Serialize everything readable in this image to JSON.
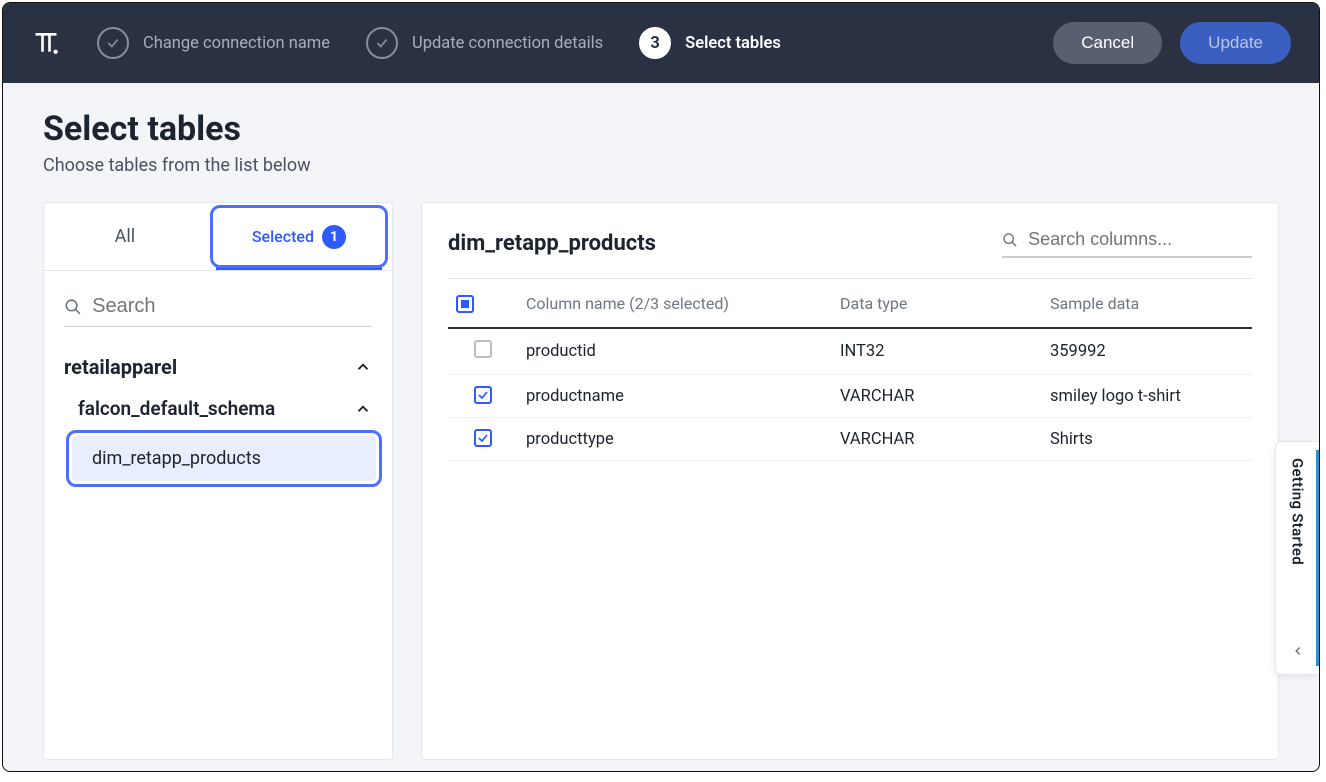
{
  "topbar": {
    "steps": [
      {
        "label": "Change connection name",
        "state": "done"
      },
      {
        "label": "Update connection details",
        "state": "done"
      },
      {
        "label": "Select tables",
        "state": "active",
        "num": "3"
      }
    ],
    "cancel": "Cancel",
    "update": "Update"
  },
  "page": {
    "title": "Select tables",
    "subtitle": "Choose tables from the list below"
  },
  "left": {
    "tabs": {
      "all": "All",
      "selected": "Selected",
      "count": "1"
    },
    "search_placeholder": "Search",
    "database": "retailapparel",
    "schema": "falcon_default_schema",
    "table": "dim_retapp_products"
  },
  "right": {
    "table_name": "dim_retapp_products",
    "search_placeholder": "Search columns...",
    "headers": {
      "col": "Column name (2/3 selected)",
      "type": "Data type",
      "sample": "Sample data"
    },
    "rows": [
      {
        "checked": false,
        "name": "productid",
        "type": "INT32",
        "sample": "359992"
      },
      {
        "checked": true,
        "name": "productname",
        "type": "VARCHAR",
        "sample": "smiley logo t-shirt"
      },
      {
        "checked": true,
        "name": "producttype",
        "type": "VARCHAR",
        "sample": "Shirts"
      }
    ]
  },
  "side_tab": "Getting Started"
}
